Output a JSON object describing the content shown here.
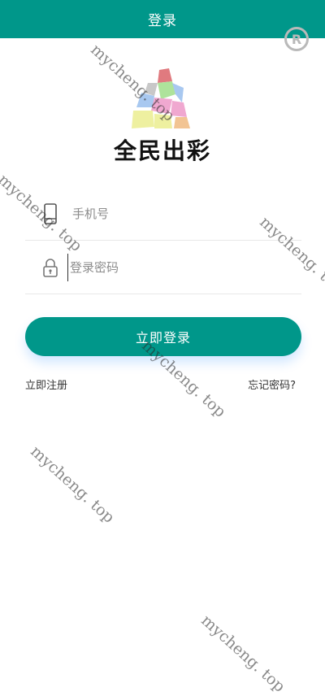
{
  "header": {
    "title": "登录"
  },
  "brand": {
    "name": "全民出彩"
  },
  "form": {
    "phone_placeholder": "手机号",
    "password_placeholder": "登录密码",
    "login_label": "立即登录",
    "register_label": "立即注册",
    "forgot_label": "忘记密码?"
  },
  "watermark": {
    "text": "mycheng. top"
  },
  "colors": {
    "primary": "#00978a"
  }
}
